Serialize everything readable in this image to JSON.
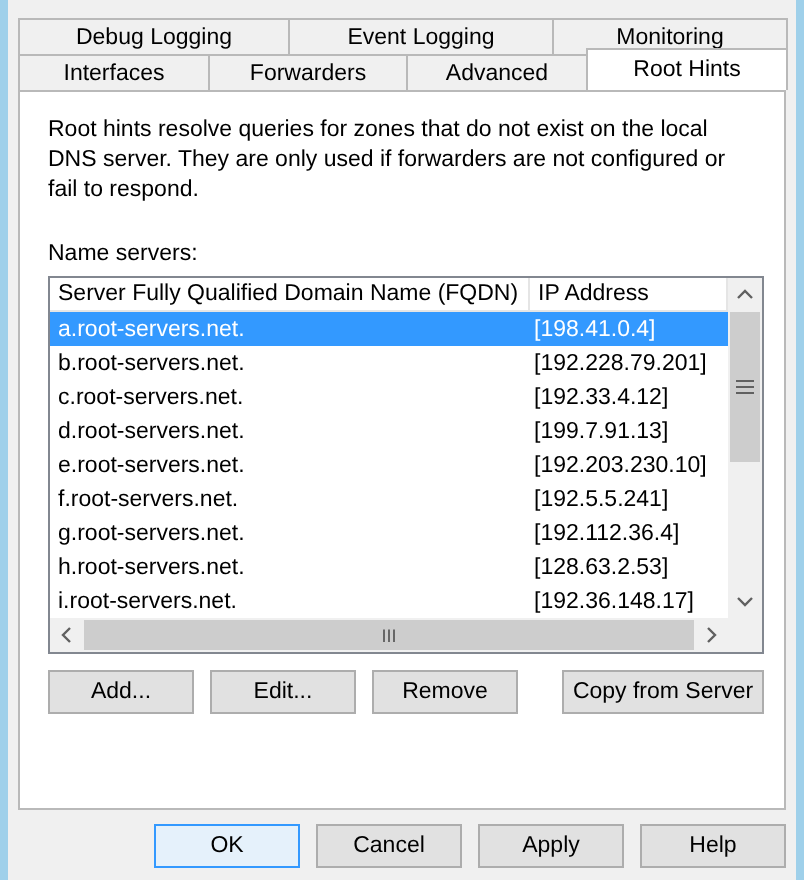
{
  "tab_rows": [
    [
      {
        "label": "Debug Logging",
        "selected": false
      },
      {
        "label": "Event Logging",
        "selected": false
      },
      {
        "label": "Monitoring",
        "selected": false
      }
    ],
    [
      {
        "label": "Interfaces",
        "selected": false
      },
      {
        "label": "Forwarders",
        "selected": false
      },
      {
        "label": "Advanced",
        "selected": false
      },
      {
        "label": "Root Hints",
        "selected": true
      }
    ]
  ],
  "description": "Root hints resolve queries for zones that do not exist on the local DNS server.  They are only used if forwarders are not configured or fail to respond.",
  "name_servers": {
    "label": "Name servers:",
    "columns": [
      "Server Fully Qualified Domain Name (FQDN)",
      "IP Address"
    ],
    "rows": [
      {
        "fqdn": "a.root-servers.net.",
        "ip": "[198.41.0.4]",
        "selected": true
      },
      {
        "fqdn": "b.root-servers.net.",
        "ip": "[192.228.79.201]",
        "selected": false
      },
      {
        "fqdn": "c.root-servers.net.",
        "ip": "[192.33.4.12]",
        "selected": false
      },
      {
        "fqdn": "d.root-servers.net.",
        "ip": "[199.7.91.13]",
        "selected": false
      },
      {
        "fqdn": "e.root-servers.net.",
        "ip": "[192.203.230.10]",
        "selected": false
      },
      {
        "fqdn": "f.root-servers.net.",
        "ip": "[192.5.5.241]",
        "selected": false
      },
      {
        "fqdn": "g.root-servers.net.",
        "ip": "[192.112.36.4]",
        "selected": false
      },
      {
        "fqdn": "h.root-servers.net.",
        "ip": "[128.63.2.53]",
        "selected": false
      },
      {
        "fqdn": "i.root-servers.net.",
        "ip": "[192.36.148.17]",
        "selected": false
      }
    ],
    "hscroll_grip": "III"
  },
  "list_buttons": [
    "Add...",
    "Edit...",
    "Remove",
    "Copy from Server"
  ],
  "dialog_buttons": [
    {
      "label": "OK",
      "default": true
    },
    {
      "label": "Cancel",
      "default": false
    },
    {
      "label": "Apply",
      "default": false
    },
    {
      "label": "Help",
      "default": false
    }
  ]
}
